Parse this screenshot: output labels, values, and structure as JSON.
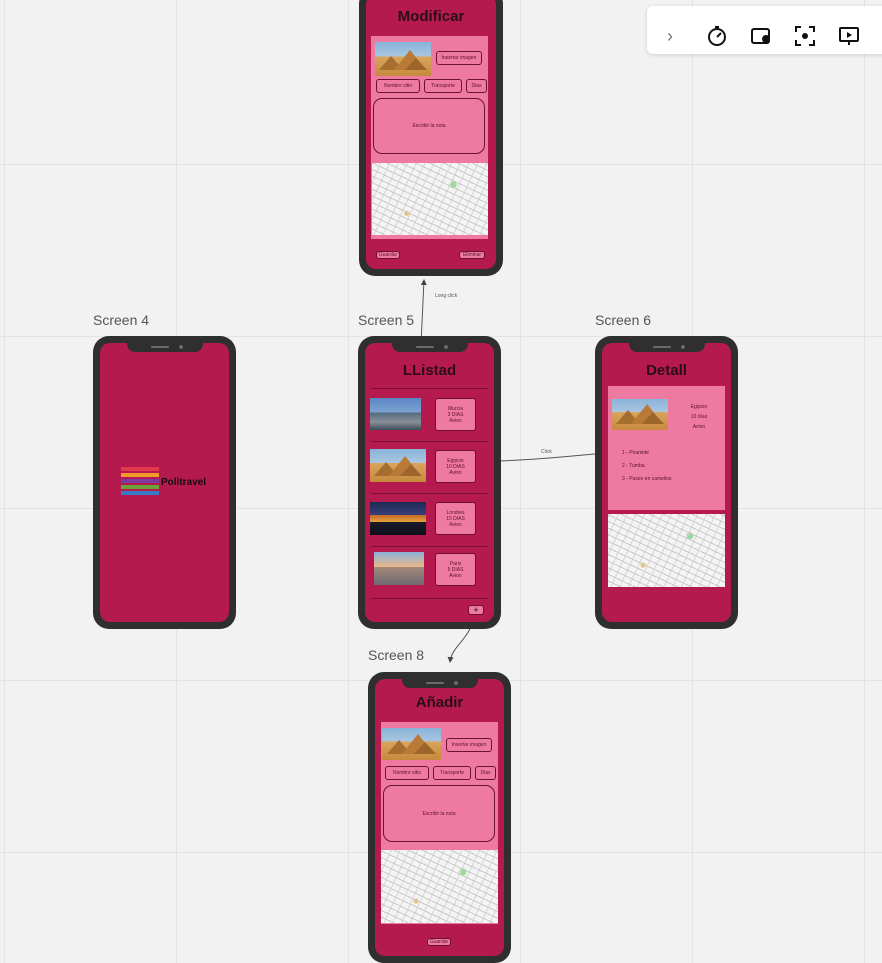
{
  "frames": [
    {
      "label": "Screen 4"
    },
    {
      "label": "Screen 5"
    },
    {
      "label": "Screen 6"
    },
    {
      "label": "Screen 8"
    }
  ],
  "toolbar": {
    "icons": [
      "chevron-right-icon",
      "timer-icon",
      "screen-note-icon",
      "focus-icon",
      "presentation-icon"
    ]
  },
  "modificar": {
    "title": "Modificar",
    "insert_image": "Insertar imagen",
    "name_label": "Nombre sitio",
    "transport_label": "Transporte",
    "days_label": "Dias",
    "note_placeholder": "Escribir la nota",
    "save": "Guardar",
    "delete": "Eliminar"
  },
  "splash": {
    "app_name": "Politravel"
  },
  "listado": {
    "title": "LListad",
    "items": [
      {
        "city": "Murcia",
        "days": "3 DIAS",
        "transport": "Avion"
      },
      {
        "city": "Egipcio",
        "days": "10 DIAS",
        "transport": "Avion"
      },
      {
        "city": "Londres",
        "days": "15 DIAS",
        "transport": "Avion"
      },
      {
        "city": "Paris",
        "days": "5 DIAS",
        "transport": "Avion"
      }
    ],
    "add_button": "+"
  },
  "detail": {
    "title": "Detall",
    "place": "Egipcio",
    "days": "10 días",
    "transport": "Avion",
    "activities": [
      "1 - Piramide",
      "2 - Tumba",
      "3 - Paseo en camellos"
    ]
  },
  "anadir": {
    "title": "Añadir",
    "insert_image": "Insertar imagen",
    "name_label": "Nombre sitio",
    "transport_label": "Transporte",
    "days_label": "Dias",
    "note_placeholder": "Escribir la nota",
    "save": "Guardar"
  },
  "connectors": {
    "long_click": "Long click",
    "click": "Click"
  }
}
